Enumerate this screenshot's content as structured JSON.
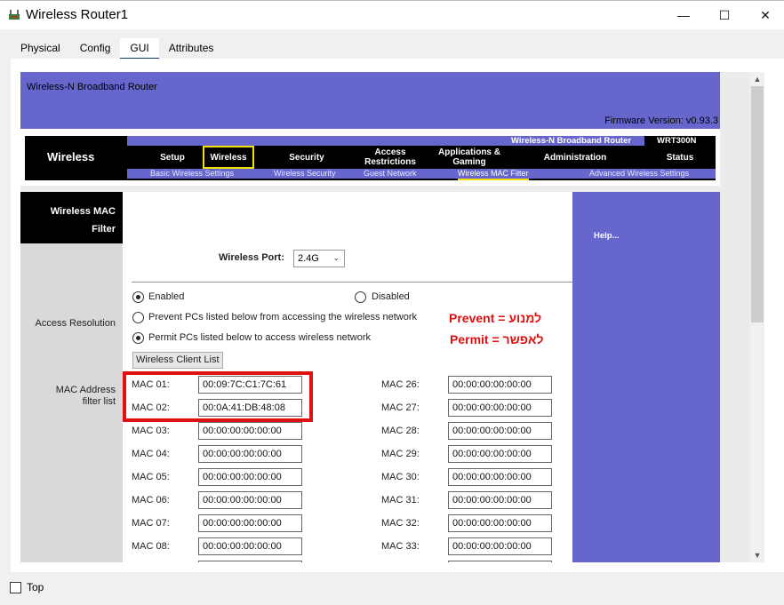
{
  "window": {
    "title": "Wireless Router1",
    "min_glyph": "—",
    "max_glyph": "☐",
    "close_glyph": "✕"
  },
  "tabs": [
    {
      "label": "Physical"
    },
    {
      "label": "Config"
    },
    {
      "label": "GUI"
    },
    {
      "label": "Attributes"
    }
  ],
  "header": {
    "product": "Wireless-N Broadband Router",
    "firmware": "Firmware Version: v0.93.3"
  },
  "nav": {
    "section": "Wireless",
    "brand": "Wireless-N Broadband Router",
    "model": "WRT300N",
    "menu": [
      {
        "label": "Setup"
      },
      {
        "label": "Wireless"
      },
      {
        "label": "Security"
      },
      {
        "label": "Access Restrictions"
      },
      {
        "label": "Applications & Gaming"
      },
      {
        "label": "Administration"
      },
      {
        "label": "Status"
      }
    ],
    "submenu": [
      {
        "label": "Basic Wireless Settings"
      },
      {
        "label": "Wireless Security"
      },
      {
        "label": "Guest Network"
      },
      {
        "label": "Wireless MAC Filter"
      },
      {
        "label": "Advanced Wireless Settings"
      }
    ]
  },
  "left": {
    "title_line1": "Wireless MAC",
    "title_line2": "Filter",
    "access_resolution": "Access Resolution",
    "mac_filter_line1": "MAC Address",
    "mac_filter_line2": "filter list"
  },
  "help": "Help...",
  "form": {
    "port_label": "Wireless Port:",
    "port_value": "2.4G",
    "enabled": "Enabled",
    "disabled": "Disabled",
    "prevent": "Prevent PCs listed below from accessing the wireless network",
    "permit": "Permit PCs listed below to access wireless network",
    "client_list_button": "Wireless Client List",
    "note_prevent": "Prevent = למנוע",
    "note_permit": "Permit = לאפשר",
    "enabled_state": "selected",
    "permit_state": "selected"
  },
  "mac_left": [
    {
      "label": "MAC 01:",
      "value": "00:09:7C:C1:7C:61"
    },
    {
      "label": "MAC 02:",
      "value": "00:0A:41:DB:48:08"
    },
    {
      "label": "MAC 03:",
      "value": "00:00:00:00:00:00"
    },
    {
      "label": "MAC 04:",
      "value": "00:00:00:00:00:00"
    },
    {
      "label": "MAC 05:",
      "value": "00:00:00:00:00:00"
    },
    {
      "label": "MAC 06:",
      "value": "00:00:00:00:00:00"
    },
    {
      "label": "MAC 07:",
      "value": "00:00:00:00:00:00"
    },
    {
      "label": "MAC 08:",
      "value": "00:00:00:00:00:00"
    }
  ],
  "mac_right": [
    {
      "label": "MAC 26:",
      "value": "00:00:00:00:00:00"
    },
    {
      "label": "MAC 27:",
      "value": "00:00:00:00:00:00"
    },
    {
      "label": "MAC 28:",
      "value": "00:00:00:00:00:00"
    },
    {
      "label": "MAC 29:",
      "value": "00:00:00:00:00:00"
    },
    {
      "label": "MAC 30:",
      "value": "00:00:00:00:00:00"
    },
    {
      "label": "MAC 31:",
      "value": "00:00:00:00:00:00"
    },
    {
      "label": "MAC 32:",
      "value": "00:00:00:00:00:00"
    },
    {
      "label": "MAC 33:",
      "value": "00:00:00:00:00:00"
    }
  ],
  "bottom": {
    "top_label": "Top"
  },
  "colors": {
    "router_purple": "#6666cc",
    "highlight_red": "#e01010",
    "selected_yellow": "#f2e000"
  }
}
